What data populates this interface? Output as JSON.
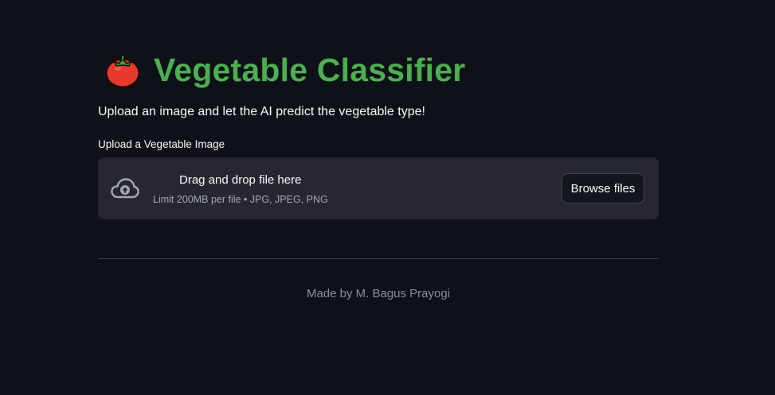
{
  "header": {
    "icon": "tomato-icon",
    "title": "Vegetable Classifier",
    "title_color": "#4caf50"
  },
  "intro": {
    "text": "Upload an image and let the AI predict the vegetable type!"
  },
  "uploader": {
    "label": "Upload a Vegetable Image",
    "icon": "cloud-upload-icon",
    "drop_title": "Drag and drop file here",
    "limit_text": "Limit 200MB per file • JPG, JPEG, PNG",
    "browse_label": "Browse files"
  },
  "footer": {
    "text": "Made by M. Bagus Prayogi"
  },
  "colors": {
    "background": "#0e1117",
    "dropzone": "#262730",
    "accent": "#4caf50"
  }
}
